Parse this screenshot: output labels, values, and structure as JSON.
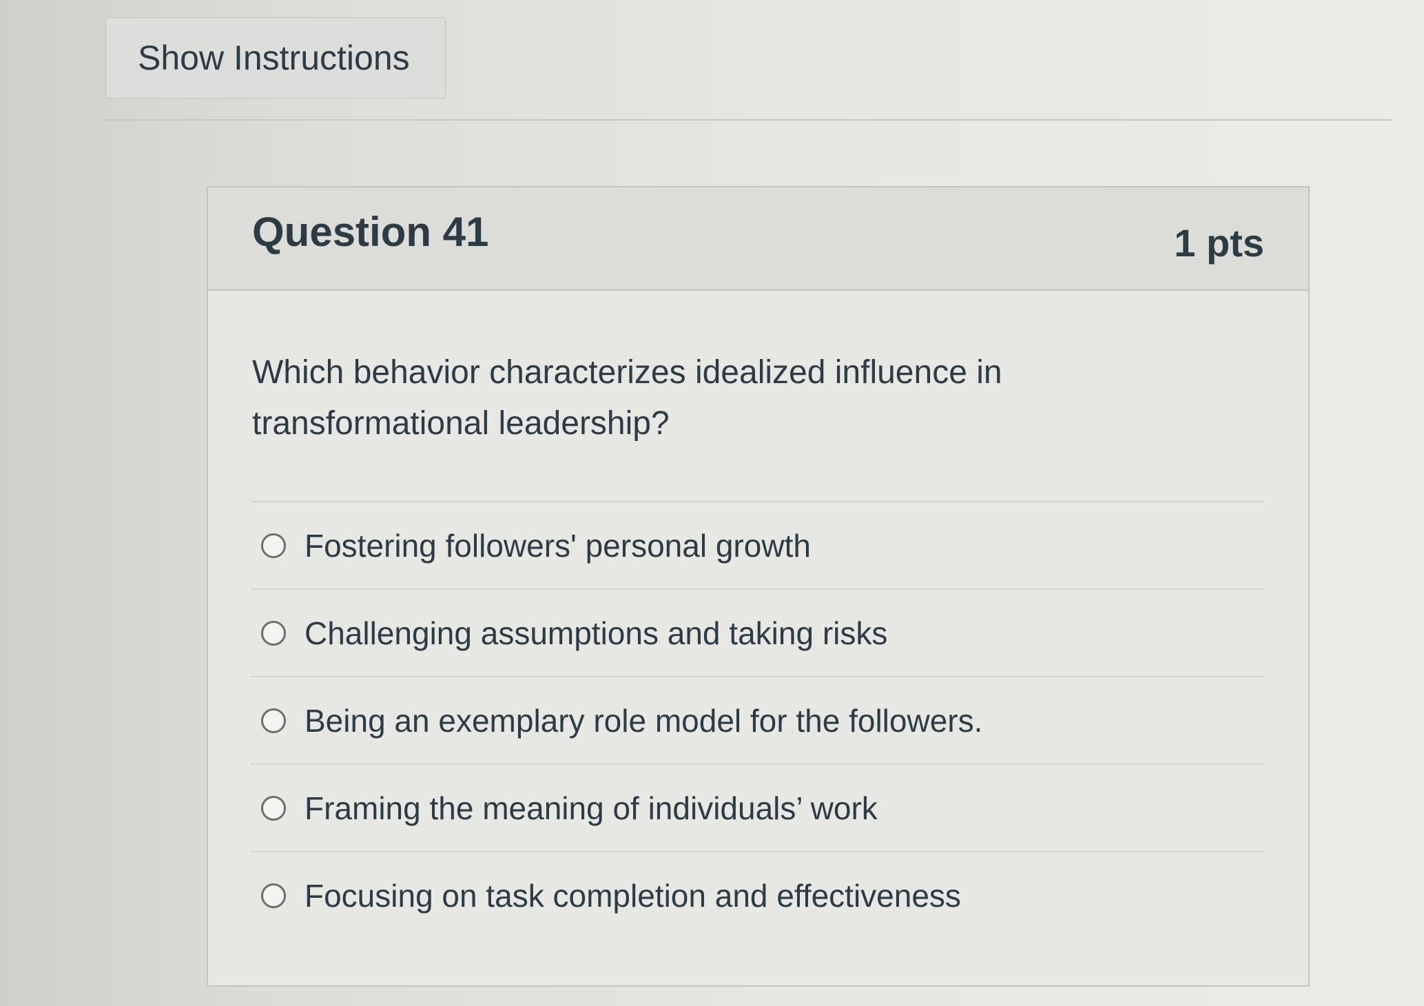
{
  "toolbar": {
    "show_instructions_label": "Show Instructions"
  },
  "question": {
    "title": "Question 41",
    "points": "1 pts",
    "text": "Which behavior characterizes idealized influence in transformational leadership?",
    "answers": [
      {
        "label": "Fostering followers' personal growth",
        "selected": false
      },
      {
        "label": "Challenging assumptions and taking risks",
        "selected": false
      },
      {
        "label": "Being an exemplary role model for the followers.",
        "selected": false
      },
      {
        "label": "Framing the meaning of individuals’ work",
        "selected": false
      },
      {
        "label": "Focusing on task completion and effectiveness",
        "selected": false
      }
    ]
  }
}
